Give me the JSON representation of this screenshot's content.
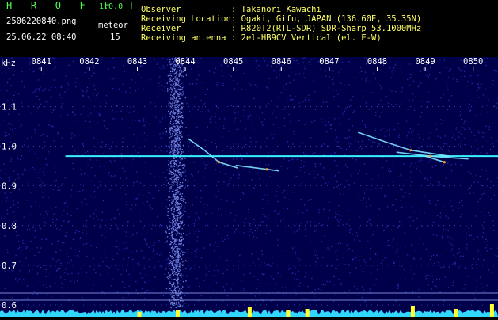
{
  "app": {
    "name": "H R O F F T",
    "version": "1.0.0",
    "filename": "2506220840.png",
    "datetime": "25.06.22 08:40",
    "meteor_label": "meteor",
    "meteor_count": "15"
  },
  "info": [
    {
      "label": "Observer",
      "value": ": Takanori Kawachi"
    },
    {
      "label": "Receiving Location",
      "value": ": Ogaki, Gifu, JAPAN (136.60E, 35.35N)"
    },
    {
      "label": "Receiver",
      "value": ": R820T2(RTL-SDR) SDR-Sharp 53.1000MHz"
    },
    {
      "label": "Receiving antenna",
      "value": ": 2el-HB9CV Vertical (el. E-W)"
    }
  ],
  "chart_data": {
    "type": "heatmap",
    "ylabel": "kHz",
    "x_ticks": [
      "0841",
      "0842",
      "0843",
      "0844",
      "0845",
      "0846",
      "0847",
      "0848",
      "0849",
      "0850"
    ],
    "y_ticks": [
      "1.1",
      "1.0",
      "0.9",
      "0.8",
      "0.7",
      "0.6"
    ],
    "y_tick_values": [
      1.1,
      1.0,
      0.9,
      0.8,
      0.7,
      0.6
    ],
    "ylim": [
      0.59,
      1.205
    ],
    "xlim": [
      0,
      10
    ],
    "carrier_khz": 0.975,
    "noise_column_minute": 3.3,
    "echoes": [
      {
        "points": [
          [
            3.55,
            1.02
          ],
          [
            3.9,
            0.99
          ],
          [
            4.2,
            0.96
          ],
          [
            4.6,
            0.945
          ]
        ]
      },
      {
        "points": [
          [
            4.55,
            0.952
          ],
          [
            5.2,
            0.942
          ],
          [
            5.45,
            0.938
          ]
        ]
      },
      {
        "points": [
          [
            7.1,
            1.035
          ],
          [
            7.7,
            1.01
          ],
          [
            8.2,
            0.99
          ],
          [
            9.0,
            0.975
          ]
        ]
      },
      {
        "points": [
          [
            7.9,
            0.985
          ],
          [
            8.6,
            0.975
          ],
          [
            9.4,
            0.968
          ]
        ]
      },
      {
        "points": [
          [
            8.5,
            0.975
          ],
          [
            8.9,
            0.96
          ]
        ]
      }
    ],
    "colors": {
      "background": "#00004a",
      "noise": "#3a4cff",
      "carrier": "#39f0ff",
      "echo": "#ff9a30",
      "bars": "#ffff33",
      "baseline": "#31d7ff"
    }
  }
}
